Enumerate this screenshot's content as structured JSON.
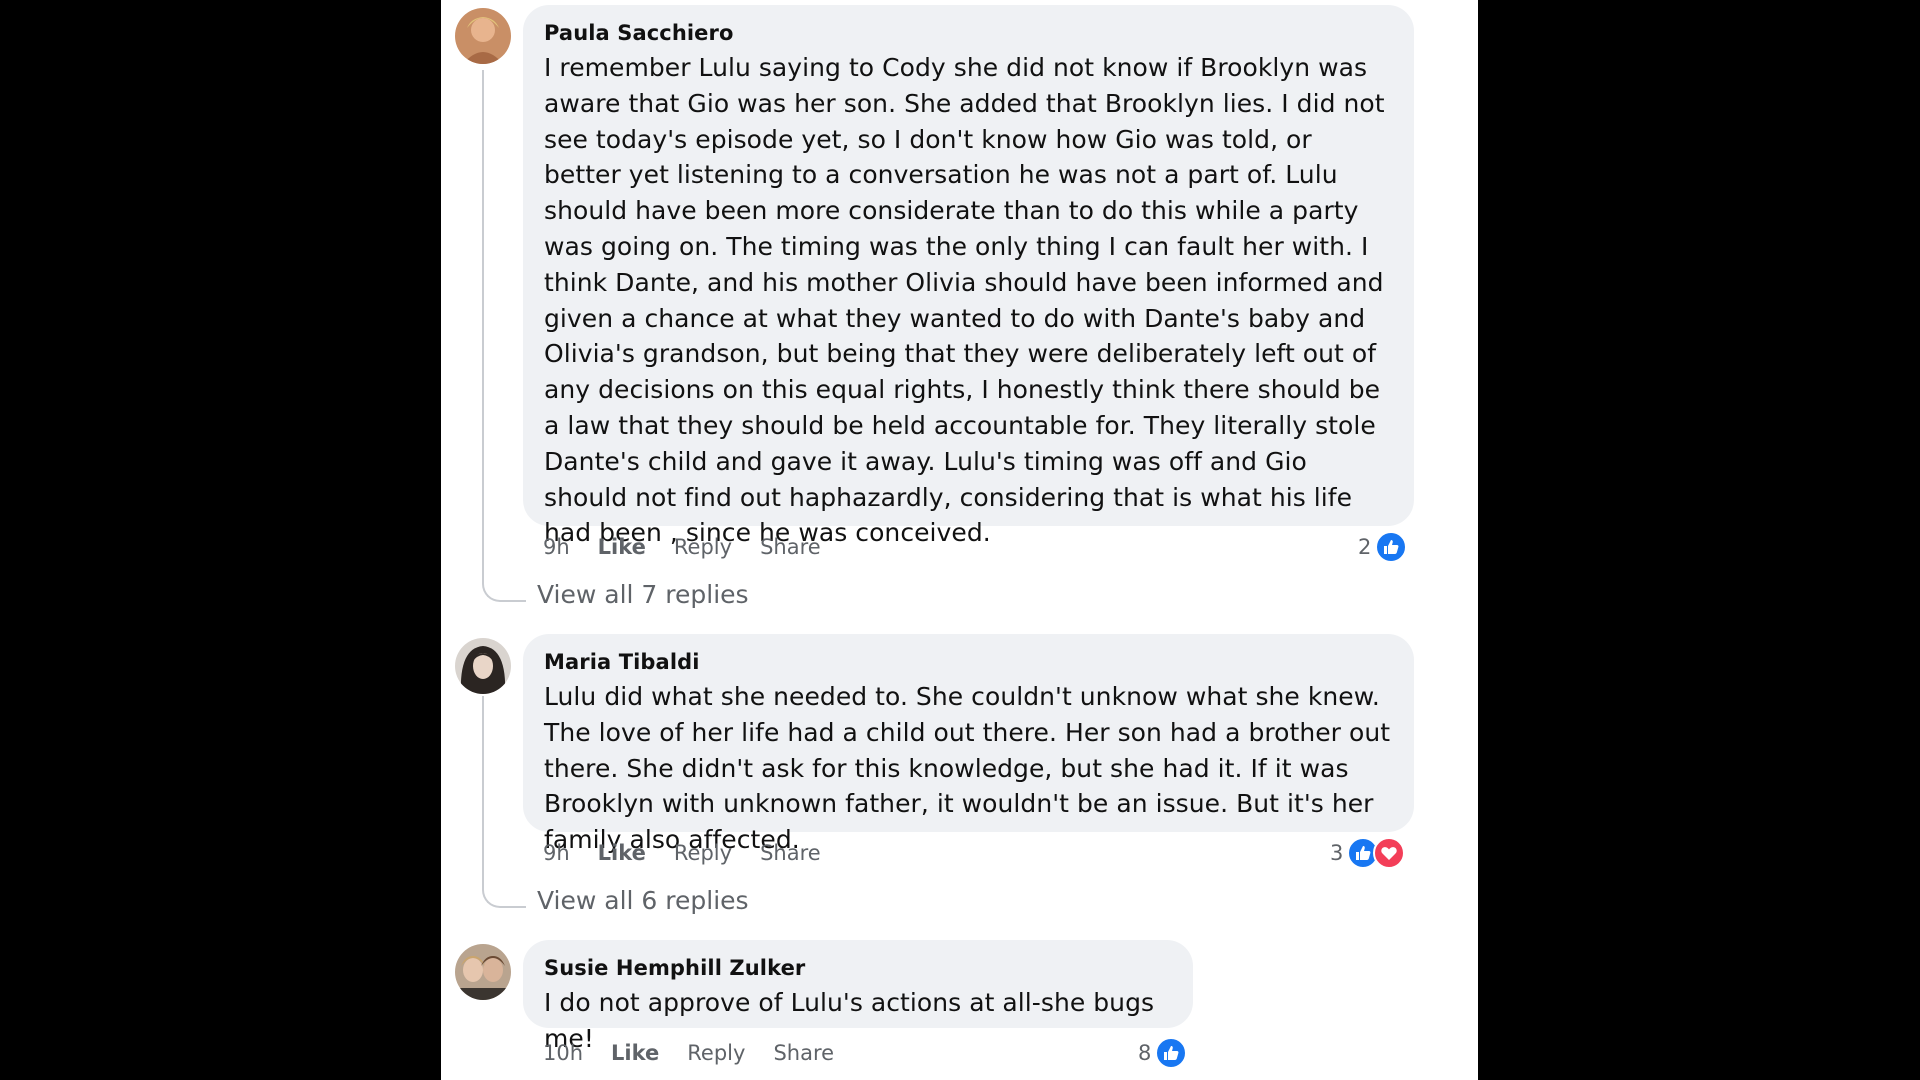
{
  "comments": [
    {
      "author": "Paula Sacchiero",
      "text": "I remember Lulu saying to Cody she did not know if Brooklyn was aware that Gio was her son. She added that Brooklyn lies. I did not see today's episode yet, so I don't know how Gio was told, or better yet listening to a conversation he was not a part of. Lulu should have been more considerate than to do this while a party was going on. The timing was the only thing I can fault her with. I think Dante, and his mother Olivia should have been informed and given a chance at what they wanted to do with Dante's baby and Olivia's grandson, but being that they were deliberately left out of any decisions on this equal rights, I honestly think there should be a law that they should be held accountable for. They literally stole Dante's child and gave it away. Lulu's timing was off and Gio should not find out haphazardly, considering that is what his life had been , since he was conceived.",
      "time": "9h",
      "like": "Like",
      "reply": "Reply",
      "share": "Share",
      "reaction_count": "2",
      "reactions": [
        "like-icon"
      ],
      "view_replies": "View all 7 replies"
    },
    {
      "author": "Maria Tibaldi",
      "text": "Lulu did what she needed to. She couldn't unknow what she knew. The love of her life had a child out there. Her son had a brother out there. She didn't ask for this knowledge, but she had it. If it was Brooklyn with unknown father, it wouldn't be an issue. But it's her family also affected.",
      "time": "9h",
      "like": "Like",
      "reply": "Reply",
      "share": "Share",
      "reaction_count": "3",
      "reactions": [
        "like-icon",
        "love-icon"
      ],
      "view_replies": "View all 6 replies"
    },
    {
      "author": "Susie Hemphill Zulker",
      "text": "I do not approve of Lulu's actions at all-she bugs me!",
      "time": "10h",
      "like": "Like",
      "reply": "Reply",
      "share": "Share",
      "reaction_count": "8",
      "reactions": [
        "like-icon"
      ]
    }
  ],
  "colors": {
    "bubble": "#eff1f4",
    "like_blue": "#1877f2",
    "love_red": "#f33e58",
    "meta_gray": "#5f6368"
  }
}
